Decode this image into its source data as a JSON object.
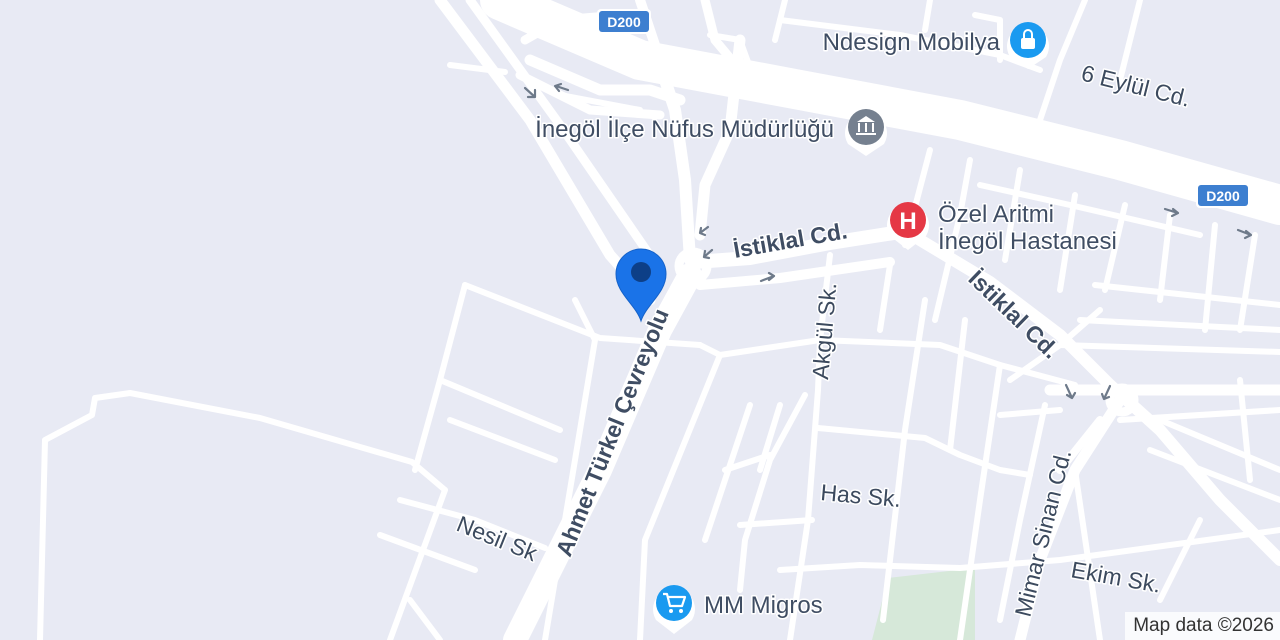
{
  "map": {
    "highway_shield": "D200",
    "roads": {
      "cevreyolu": "Ahmet Türkel Çevreyolu",
      "istiklal_main": "İstiklal Cd.",
      "istiklal_south": "İstiklal Cd.",
      "akgul": "Akgül Sk.",
      "alti_eylul": "6 Eylül Cd.",
      "has": "Has Sk.",
      "nesil": "Nesil Sk",
      "mimar_sinan": "Mimar Sinan Cd.",
      "ekim": "Ekim Sk."
    },
    "pois": {
      "ndesign": "Ndesign Mobilya",
      "nufus": "İnegöl İlçe Nüfus Müdürlüğü",
      "hospital_line1": "Özel Aritmi",
      "hospital_line2": "İnegöl Hastanesi",
      "migros": "MM Migros"
    },
    "icons": {
      "shopping": "shopping-bag-icon",
      "government": "government-building-icon",
      "hospital": "hospital-icon",
      "cart": "shopping-cart-icon",
      "location": "location-pin-icon"
    },
    "hospital_glyph": "H",
    "colors": {
      "background": "#e8eaf4",
      "road": "#ffffff",
      "park": "#d6e8d9",
      "shield": "#3d7fd0",
      "poi_blue": "#1a9af0",
      "poi_gray": "#75808f",
      "poi_red": "#e53845",
      "pin": "#1a73e8"
    },
    "attribution": "Map data ©2026"
  }
}
